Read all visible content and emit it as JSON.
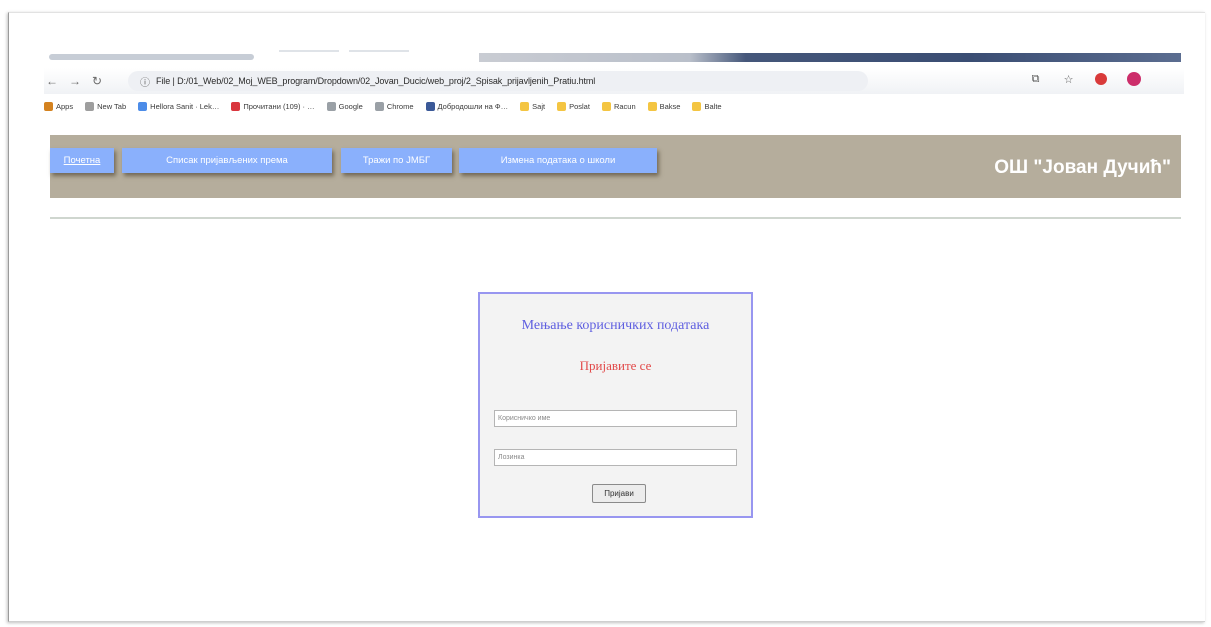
{
  "browser": {
    "address": "File  |  D:/01_Web/02_Moj_WEB_program/Dropdown/02_Jovan_Ducic/web_proj/2_Spisak_prijavljenih_Pratiu.html",
    "info_icon": "info-circle",
    "nav_icons": [
      "back-arrow",
      "forward-arrow",
      "reload-icon"
    ],
    "right_icons": [
      "translate-icon",
      "star-icon",
      "opera-icon",
      "profile-icon"
    ]
  },
  "bookmarks": [
    {
      "label": "Apps",
      "icon": "apps-grid",
      "color": "#d4821f"
    },
    {
      "label": "New Tab",
      "icon": "page-icon",
      "color": "#9e9e9e"
    },
    {
      "label": "Hellora Sanit · Lek…",
      "icon": "shield",
      "color": "#4c8ce8"
    },
    {
      "label": "Прочитани (109) · …",
      "icon": "gmail",
      "color": "#d9363e"
    },
    {
      "label": "Google",
      "icon": "google",
      "color": "#9aa0a6"
    },
    {
      "label": "Chrome",
      "icon": "google",
      "color": "#9aa0a6"
    },
    {
      "label": "Добродошли на Ф…",
      "icon": "facebook",
      "color": "#3b5998"
    },
    {
      "label": "Sajt",
      "icon": "folder",
      "color": "#f4c542"
    },
    {
      "label": "Poslat",
      "icon": "folder",
      "color": "#f4c542"
    },
    {
      "label": "Racun",
      "icon": "folder",
      "color": "#f4c542"
    },
    {
      "label": "Bakse",
      "icon": "folder",
      "color": "#f4c542"
    },
    {
      "label": "Balte",
      "icon": "folder",
      "color": "#f4c542"
    }
  ],
  "header": {
    "nav": [
      {
        "label": "Почетна"
      },
      {
        "label": "Списак пријављених према"
      },
      {
        "label": "Тражи по ЈМБГ"
      },
      {
        "label": "Измена података о школи"
      }
    ],
    "brand": "ОШ \"Јован Дучић\"",
    "colors": {
      "bar": "#b5ad9c",
      "button": "#8ab0fc"
    }
  },
  "login": {
    "title": "Мењање корисничких података",
    "subtitle": "Пријавите се",
    "username_placeholder": "Корисничко име",
    "password_placeholder": "Лозинка",
    "submit_label": "Пријави",
    "colors": {
      "title": "#5f5fe0",
      "subtitle": "#e24a4a",
      "border": "#9896f0"
    }
  }
}
